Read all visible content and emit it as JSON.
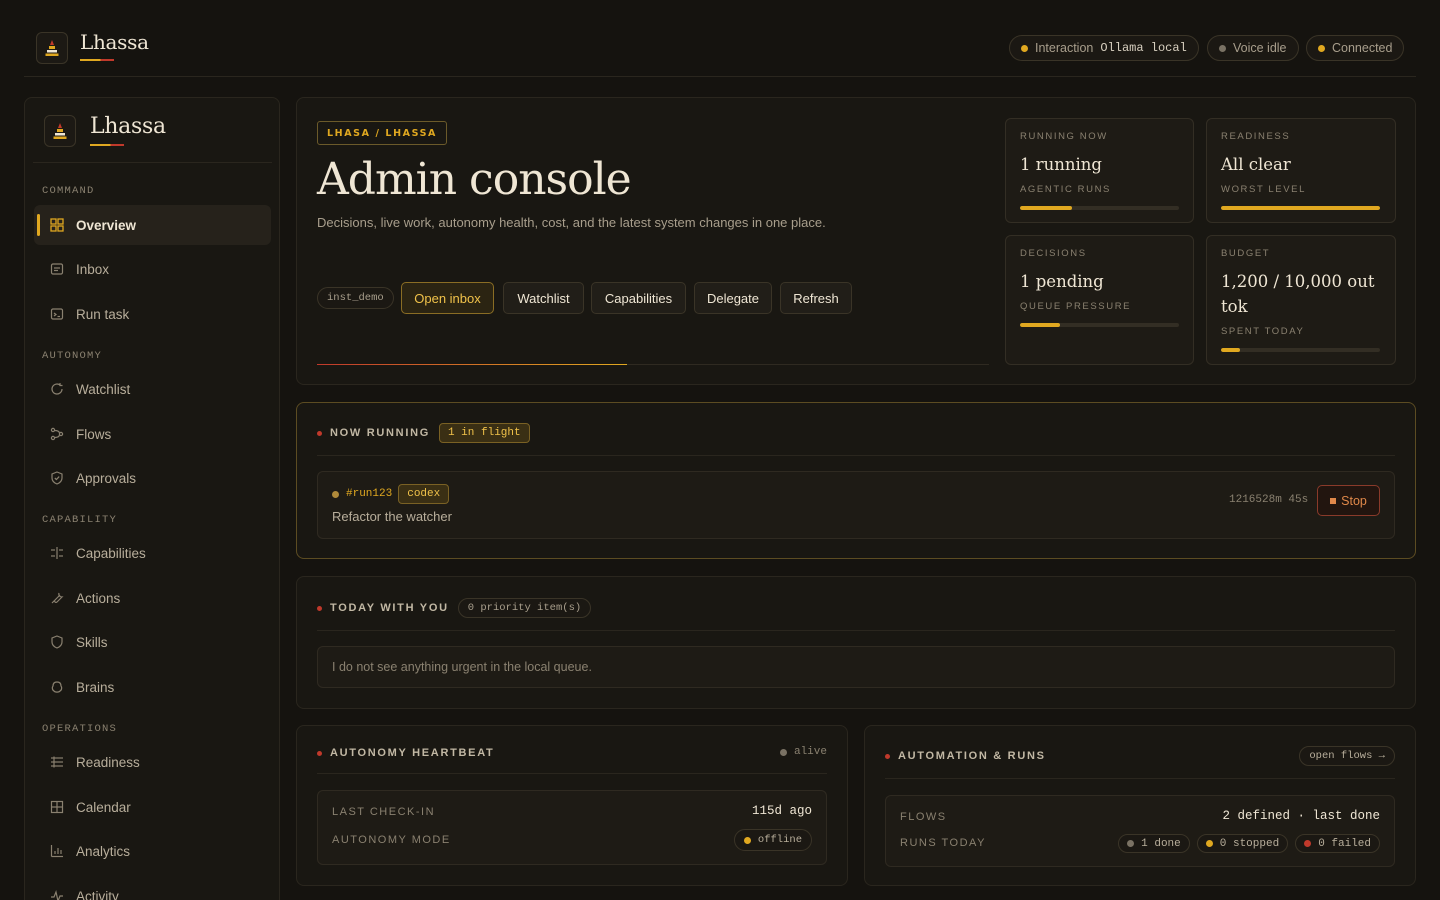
{
  "app": {
    "name": "Lhassa"
  },
  "topbar": {
    "interaction_label": "Interaction",
    "interaction_value": "Ollama local",
    "voice": "Voice idle",
    "connection": "Connected"
  },
  "sidebar": {
    "brand": "Lhassa",
    "sections": [
      {
        "title": "COMMAND",
        "items": [
          {
            "label": "Overview",
            "icon": "grid-icon",
            "active": true
          },
          {
            "label": "Inbox",
            "icon": "inbox-icon"
          },
          {
            "label": "Run task",
            "icon": "terminal-icon"
          }
        ]
      },
      {
        "title": "AUTONOMY",
        "items": [
          {
            "label": "Watchlist",
            "icon": "refresh-icon"
          },
          {
            "label": "Flows",
            "icon": "flow-icon"
          },
          {
            "label": "Approvals",
            "icon": "shield-check-icon"
          }
        ]
      },
      {
        "title": "CAPABILITY",
        "items": [
          {
            "label": "Capabilities",
            "icon": "capabilities-icon"
          },
          {
            "label": "Actions",
            "icon": "wrench-icon"
          },
          {
            "label": "Skills",
            "icon": "shield-icon"
          },
          {
            "label": "Brains",
            "icon": "brain-icon"
          }
        ]
      },
      {
        "title": "OPERATIONS",
        "items": [
          {
            "label": "Readiness",
            "icon": "list-check-icon"
          },
          {
            "label": "Calendar",
            "icon": "calendar-icon"
          },
          {
            "label": "Analytics",
            "icon": "bar-chart-icon"
          },
          {
            "label": "Activity",
            "icon": "activity-icon"
          }
        ]
      }
    ]
  },
  "hero": {
    "tag": "LHASA / LHASSA",
    "title": "Admin console",
    "subtitle": "Decisions, live work, autonomy health, cost, and the latest system changes in one place.",
    "instance": "inst_demo",
    "buttons": {
      "open_inbox": "Open inbox",
      "watchlist": "Watchlist",
      "capabilities": "Capabilities",
      "delegate": "Delegate",
      "refresh": "Refresh"
    }
  },
  "stats": {
    "running": {
      "label": "RUNNING NOW",
      "value": "1 running",
      "sub": "AGENTIC RUNS",
      "fill": 0.33
    },
    "readiness": {
      "label": "READINESS",
      "value": "All clear",
      "sub": "WORST LEVEL",
      "fill": 1.0
    },
    "decisions": {
      "label": "DECISIONS",
      "value": "1 pending",
      "sub": "QUEUE PRESSURE",
      "fill": 0.25
    },
    "budget": {
      "label": "BUDGET",
      "value": "1,200 / 10,000 out tok",
      "sub": "SPENT TODAY",
      "fill": 0.12
    }
  },
  "now_running": {
    "title": "NOW RUNNING",
    "count": "1 in flight",
    "run": {
      "id": "#run123",
      "agent": "codex",
      "task": "Refactor the watcher",
      "elapsed": "1216528m 45s",
      "stop": "Stop"
    }
  },
  "today": {
    "title": "TODAY WITH YOU",
    "count": "0 priority item(s)",
    "message": "I do not see anything urgent in the local queue."
  },
  "heartbeat": {
    "title": "AUTONOMY HEARTBEAT",
    "status": "alive",
    "last_checkin_label": "LAST CHECK-IN",
    "last_checkin_value": "115d ago",
    "mode_label": "AUTONOMY MODE",
    "mode_value": "offline"
  },
  "automation": {
    "title": "AUTOMATION & RUNS",
    "link": "open flows →",
    "flows_label": "FLOWS",
    "flows_value": "2 defined · last done",
    "runs_label": "RUNS TODAY",
    "done": "1 done",
    "stopped": "0 stopped",
    "failed": "0 failed"
  },
  "colors": {
    "background": "#15130f",
    "panel": "#191712",
    "accent": "#e0a820",
    "danger": "#c0392b",
    "text": "#efe6d4"
  }
}
